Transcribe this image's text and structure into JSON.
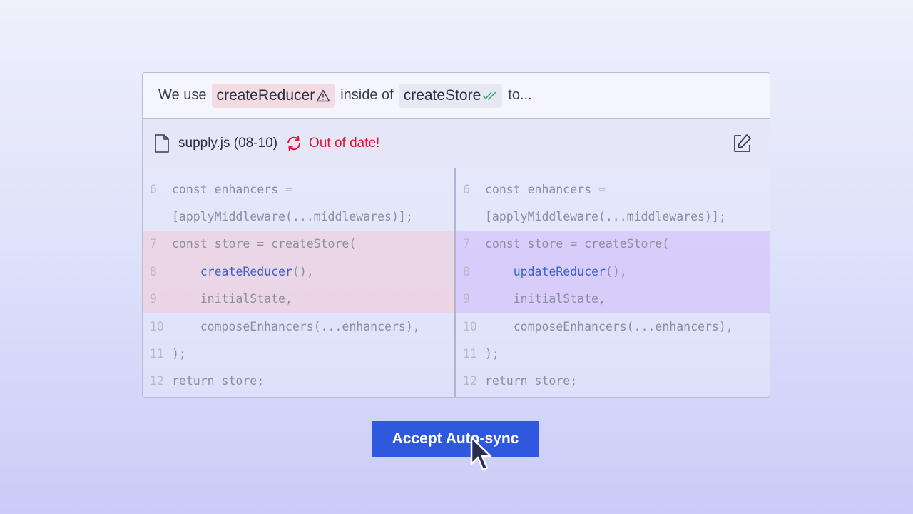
{
  "sentence": {
    "prefix": "We use",
    "chip1": {
      "label": "createReducer",
      "icon": "warning-icon"
    },
    "middle": "inside of",
    "chip2": {
      "label": "createStore",
      "icon": "double-check-icon"
    },
    "suffix": "to..."
  },
  "file": {
    "name": "supply.js (08-10)",
    "status": "Out of date!",
    "status_color": "#e0152f"
  },
  "diff": {
    "left": [
      {
        "num": "6",
        "code": "const enhancers ="
      },
      {
        "num": "",
        "code": "[applyMiddleware(...middlewares)];"
      },
      {
        "num": "7",
        "code": "const store = createStore("
      },
      {
        "num": "8",
        "pre": "    ",
        "fn": "createReducer",
        "post": "(),"
      },
      {
        "num": "9",
        "code": "    initialState,"
      },
      {
        "num": "10",
        "code": "    composeEnhancers(...enhancers),"
      },
      {
        "num": "11",
        "code": ");"
      },
      {
        "num": "12",
        "code": "return store;"
      }
    ],
    "right": [
      {
        "num": "6",
        "code": "const enhancers ="
      },
      {
        "num": "",
        "code": "[applyMiddleware(...middlewares)];"
      },
      {
        "num": "7",
        "code": "const store = createStore("
      },
      {
        "num": "8",
        "pre": "    ",
        "fn": "updateReducer",
        "post": "(),"
      },
      {
        "num": "9",
        "code": "    initialState,"
      },
      {
        "num": "10",
        "code": "    composeEnhancers(...enhancers),"
      },
      {
        "num": "11",
        "code": ");"
      },
      {
        "num": "12",
        "code": "return store;"
      }
    ]
  },
  "button": {
    "label": "Accept Auto-sync",
    "color": "#2f58de"
  },
  "colors": {
    "removed_bg": "#eed0de",
    "added_bg": "#d6c8fa",
    "fn_highlight": "#3d63c9"
  }
}
